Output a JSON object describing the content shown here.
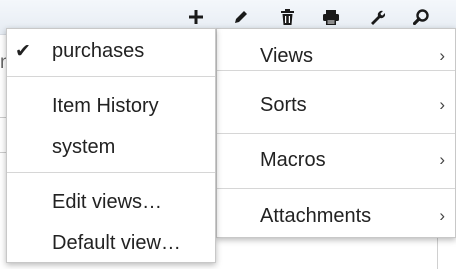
{
  "toolbar": {
    "icons": [
      "plus-icon",
      "pencil-icon",
      "trash-icon",
      "print-icon",
      "wrench-icon",
      "search-icon"
    ]
  },
  "background": {
    "fragment": "n"
  },
  "submenu": {
    "items": [
      {
        "label": "Views",
        "arrow": "›"
      },
      {
        "label": "Sorts",
        "arrow": "›"
      },
      {
        "label": "Macros",
        "arrow": "›"
      },
      {
        "label": "Attachments",
        "arrow": "›"
      }
    ]
  },
  "views_menu": {
    "check_glyph": "✔",
    "items": [
      {
        "label": "purchases",
        "checked": true
      },
      {
        "label": "Item History",
        "checked": false
      },
      {
        "label": "system",
        "checked": false
      },
      {
        "label": "Edit views…",
        "checked": false
      },
      {
        "label": "Default view…",
        "checked": false
      }
    ]
  }
}
